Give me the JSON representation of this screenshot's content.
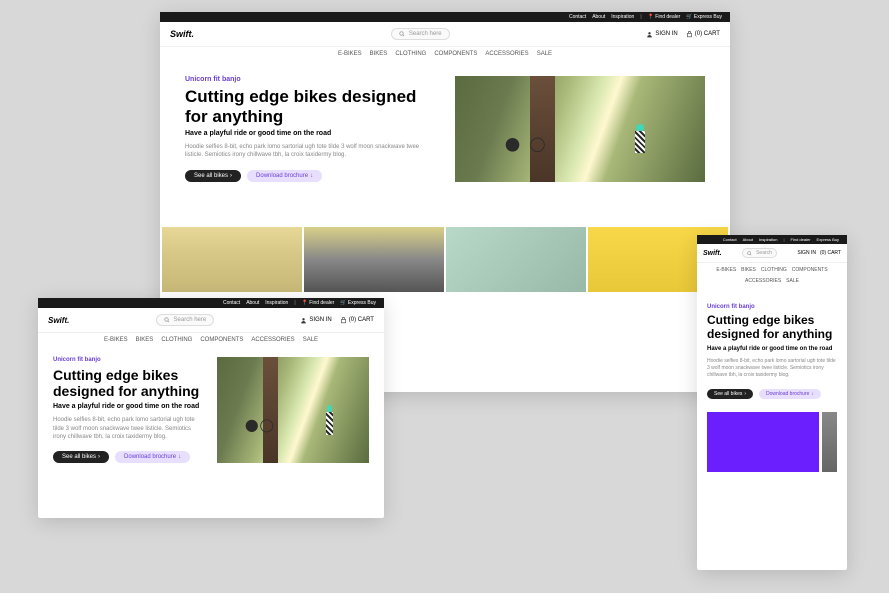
{
  "topbar": {
    "contact": "Contact",
    "about": "About",
    "inspiration": "Inspiration",
    "find_dealer": "Find dealer",
    "express_buy": "Express Buy"
  },
  "header": {
    "logo": "Swift.",
    "search_placeholder": "Search here",
    "signin": "SIGN IN",
    "cart": "(0) CART"
  },
  "nav": {
    "ebikes": "E-BIKES",
    "bikes": "BIKES",
    "clothing": "CLOTHING",
    "components": "COMPONENTS",
    "accessories": "ACCESSORIES",
    "sale": "SALE"
  },
  "hero": {
    "eyebrow": "Unicorn fit banjo",
    "h1": "Cutting edge bikes designed for anything",
    "sub": "Have a playful ride or good time on the road",
    "body": "Hoodie selfies 8-bit, echo park lomo sartorial ugh tote tilde 3 wolf moon snackwave twee listicle. Semiotics irony chillwave tbh, la croix taxidermy blog.",
    "btn_primary": "See all bikes",
    "btn_secondary": "Download brochure"
  }
}
